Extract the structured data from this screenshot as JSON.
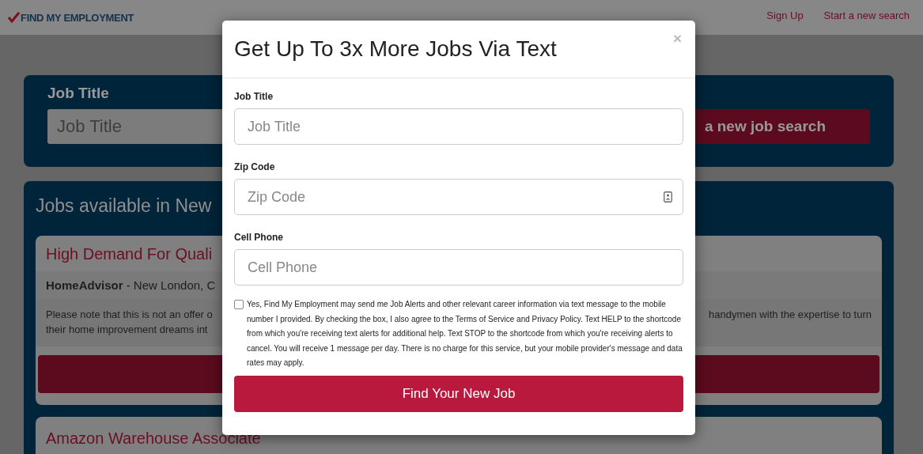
{
  "header": {
    "logo": "FIND MY EMPLOYMENT",
    "links": [
      "Sign Up",
      "Start a new search"
    ]
  },
  "search": {
    "label": "Job Title",
    "placeholder": "Job Title",
    "button": "a new job search"
  },
  "results": {
    "heading": "Jobs available in New",
    "jobs": [
      {
        "title": "High Demand For Quali",
        "info": "**HomeAdvisor** - New London, C",
        "description": [
          "Please note that this is not an offer o",
          "their home improvement dreams int"
        ],
        "description_right": "handymen with the expertise to turn",
        "has_button": true
      },
      {
        "title": "Amazon Warehouse Associate",
        "has_button": false
      }
    ]
  },
  "modal": {
    "title": "Get Up To 3x More Jobs Via Text",
    "close": "×",
    "fields": [
      {
        "label": "Job Title",
        "placeholder": "Job Title",
        "kind": "plain"
      },
      {
        "label": "Zip Code",
        "placeholder": "Zip Code",
        "kind": "contact"
      },
      {
        "label": "Cell Phone",
        "placeholder": "Cell Phone",
        "kind": "plain"
      }
    ],
    "consent": {
      "checked": false,
      "text": "Yes, Find My Employment may send me Job Alerts and other relevant career information via text message to the mobile number I provided. By checking the box, I also agree to the Terms of Service and Privacy Policy. Text HELP to the shortcode from which you're receiving text alerts for additional help. Text STOP to the shortcode from which you're receiving alerts to cancel. You will receive 1 message per day. There is no charge for this service, but your mobile provider's message and data rates may apply."
    },
    "submit": "Find Your New Job"
  }
}
